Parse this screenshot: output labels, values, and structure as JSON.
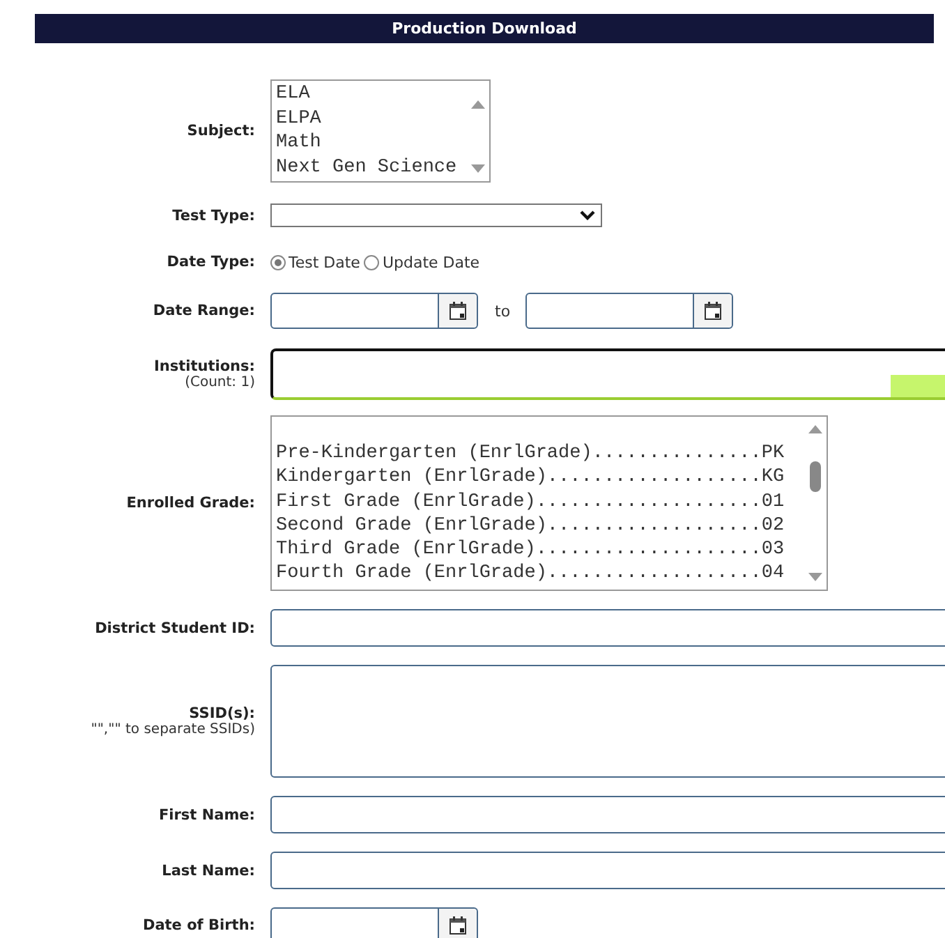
{
  "header": {
    "title": "Production Download"
  },
  "fields": [
    {
      "kind": "listbox",
      "label": "Subject:",
      "options": [
        "ELA",
        "ELPA",
        "Math",
        "Next Gen Science"
      ]
    },
    {
      "kind": "select",
      "label": "Test Type:"
    },
    {
      "kind": "radios",
      "label": "Date Type:",
      "options": [
        {
          "label": "Test Date",
          "selected": true
        },
        {
          "label": "Update Date",
          "selected": false
        }
      ]
    },
    {
      "kind": "daterange",
      "label": "Date Range:",
      "separator": "to"
    },
    {
      "kind": "institutions",
      "label": "Institutions:",
      "note": "(Count: 1)"
    },
    {
      "kind": "gradelist",
      "label": "Enrolled Grade:",
      "options": [
        "Pre-Kindergarten (EnrlGrade)...............PK",
        "Kindergarten (EnrlGrade)...................KG",
        "First Grade (EnrlGrade)....................01",
        "Second Grade (EnrlGrade)...................02",
        "Third Grade (EnrlGrade)....................03",
        "Fourth Grade (EnrlGrade)...................04"
      ]
    },
    {
      "kind": "text",
      "label": "District Student ID:"
    },
    {
      "kind": "textarea",
      "label": "SSID(s):",
      "note": "\"\",\"\" to separate SSIDs)"
    },
    {
      "kind": "text",
      "label": "First Name:"
    },
    {
      "kind": "text",
      "label": "Last Name:"
    },
    {
      "kind": "date",
      "label": "Date of Birth:"
    }
  ]
}
